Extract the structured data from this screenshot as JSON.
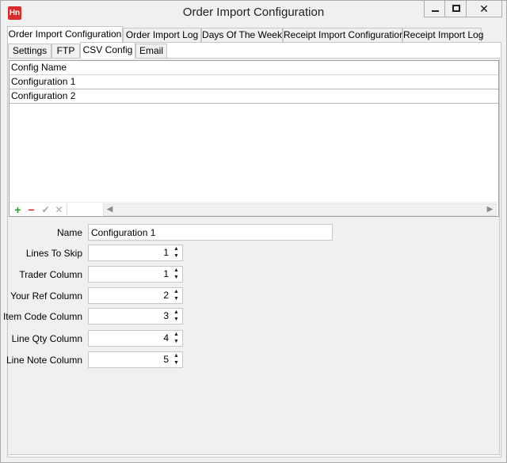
{
  "window": {
    "title": "Order Import Configuration",
    "icon_text": "Hn",
    "controls": {
      "minimize": "minimize",
      "maximize": "maximize",
      "close": "✕"
    }
  },
  "main_tabs": [
    {
      "label": "Order Import Configuration",
      "active": true
    },
    {
      "label": "Order Import Log",
      "active": false
    },
    {
      "label": "Days Of The Week",
      "active": false
    },
    {
      "label": "Receipt Import Configuration",
      "active": false
    },
    {
      "label": "Receipt Import Log",
      "active": false
    }
  ],
  "sub_tabs": [
    {
      "label": "Settings",
      "active": false
    },
    {
      "label": "FTP",
      "active": false
    },
    {
      "label": "CSV Config",
      "active": true
    },
    {
      "label": "Email",
      "active": false
    }
  ],
  "grid": {
    "column_header": "Config Name",
    "rows": [
      "Configuration 1",
      "Configuration 2"
    ],
    "navigator": {
      "add": "+",
      "remove": "−",
      "accept": "✔",
      "cancel": "✕",
      "scroll_left": "◀",
      "scroll_right": "▶"
    }
  },
  "form": {
    "name": {
      "label": "Name",
      "value": "Configuration 1"
    },
    "fields": [
      {
        "label": "Lines To Skip",
        "value": "1"
      },
      {
        "label": "Trader Column",
        "value": "1"
      },
      {
        "label": "Your Ref Column",
        "value": "2"
      },
      {
        "label": "Item Code Column",
        "value": "3"
      },
      {
        "label": "Line Qty Column",
        "value": "4"
      },
      {
        "label": "Line Note Column",
        "value": "5"
      }
    ],
    "spin_up": "▲",
    "spin_down": "▼"
  },
  "colors": {
    "icon_red": "#d92b2b",
    "add_green": "#2a9a2a",
    "window_bg": "#f0f0f0"
  }
}
